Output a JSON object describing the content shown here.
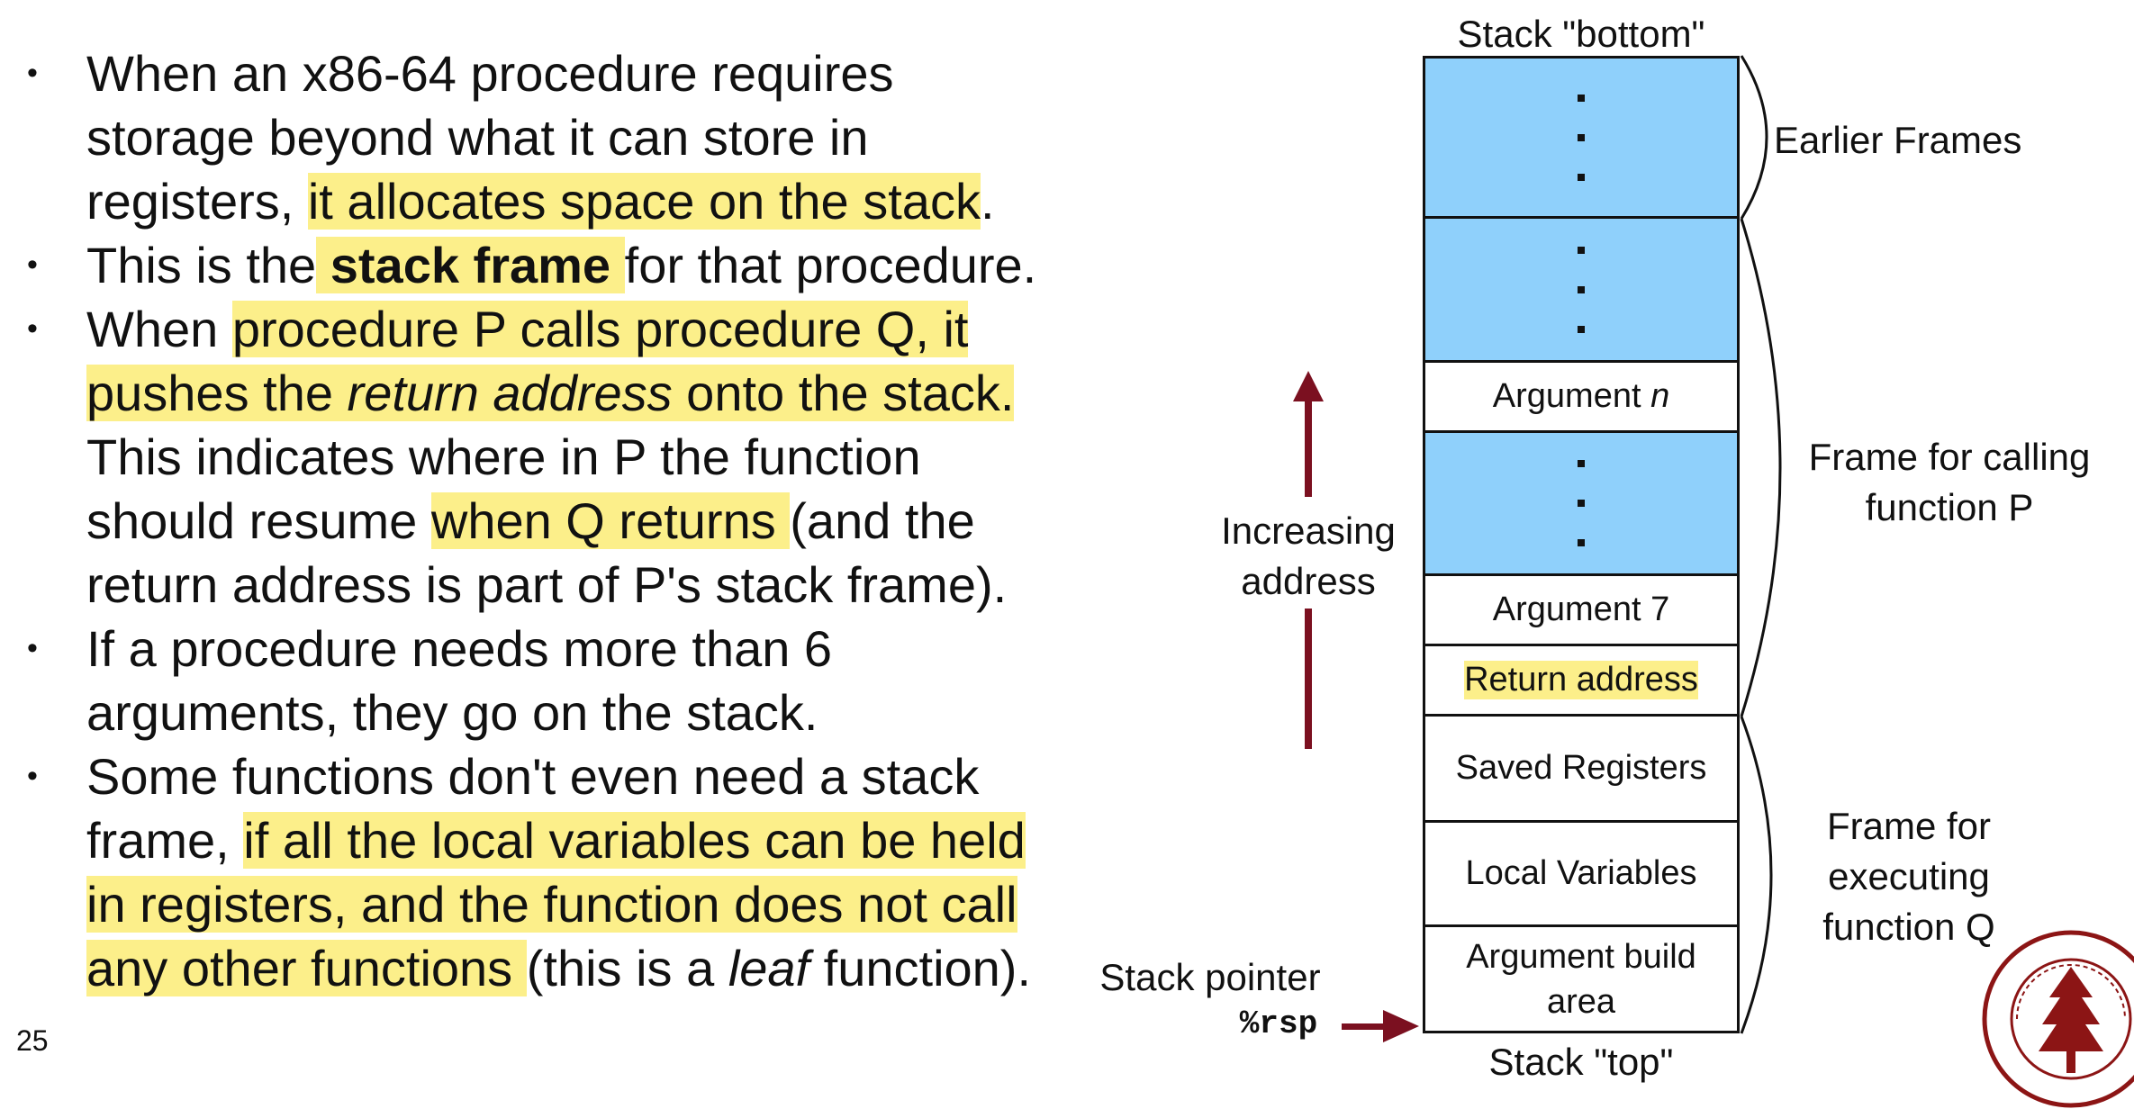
{
  "bullets": [
    {
      "parts": [
        {
          "t": "When an x86-64 procedure requires storage beyond what it can store in registers, "
        },
        {
          "t": "it allocates space on the stack",
          "hl": true
        },
        {
          "t": "."
        }
      ]
    },
    {
      "parts": [
        {
          "t": "This is the"
        },
        {
          "t": " stack frame ",
          "hl": true,
          "b": true
        },
        {
          "t": "for that procedure."
        }
      ]
    },
    {
      "parts": [
        {
          "t": "When "
        },
        {
          "t": "procedure P calls procedure Q, it pushes the ",
          "hl": true
        },
        {
          "t": "return address",
          "hl": true,
          "i": true
        },
        {
          "t": " onto the stack.",
          "hl": true
        },
        {
          "t": " This indicates where in P the function should resume "
        },
        {
          "t": "when Q returns ",
          "hl": true
        },
        {
          "t": "(and the return address is part of P's stack frame)."
        }
      ]
    },
    {
      "parts": [
        {
          "t": "If a procedure needs more than 6 arguments, they go on the stack."
        }
      ]
    },
    {
      "parts": [
        {
          "t": "Some functions don't even need a stack frame, "
        },
        {
          "t": "if all the local variables can be held in registers, and the function does not call any other functions ",
          "hl": true
        },
        {
          "t": "(this is a "
        },
        {
          "t": "leaf",
          "i": true
        },
        {
          "t": " function)."
        }
      ]
    }
  ],
  "slide_number": "25",
  "diagram": {
    "top_label": "Stack \"bottom\"",
    "bottom_label": "Stack \"top\"",
    "cells": {
      "arg_n_prefix": "Argument ",
      "arg_n_var": "n",
      "arg7": "Argument 7",
      "return_address": "Return address",
      "saved_registers": "Saved Registers",
      "local_variables": "Local Variables",
      "arg_build": "Argument build area"
    },
    "braces": {
      "earlier": "Earlier Frames",
      "calling": "Frame for calling function P",
      "executing": "Frame for executing function Q"
    },
    "increasing_address": "Increasing address",
    "stack_pointer": "Stack pointer",
    "rsp": "%rsp"
  },
  "colors": {
    "highlight": "#fcef8a",
    "stack_fill": "#8fd0fb",
    "arrow": "#7b1020"
  }
}
